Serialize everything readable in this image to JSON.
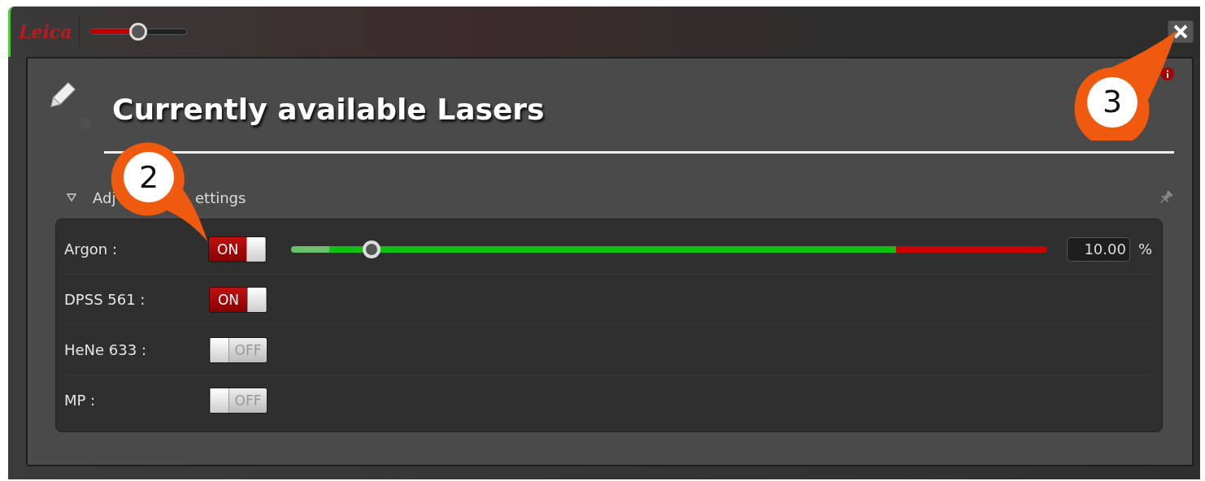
{
  "header": {
    "logo": "Leica",
    "zoom_slider": {
      "level": 0.5
    }
  },
  "panel": {
    "title": "Currently available Lasers"
  },
  "section": {
    "title_visible_start": "Adj",
    "title_visible_end": "ettings",
    "expanded": true,
    "lasers": [
      {
        "name": "Argon :",
        "on": true,
        "toggle_label": "ON",
        "power": {
          "level": 0.107,
          "value": "10.00",
          "unit": "%"
        }
      },
      {
        "name": "DPSS 561 :",
        "on": true,
        "toggle_label": "ON"
      },
      {
        "name": "HeNe 633 :",
        "on": false,
        "toggle_label": "OFF"
      },
      {
        "name": "MP :",
        "on": false,
        "toggle_label": "OFF"
      }
    ]
  },
  "callouts": [
    {
      "number": "2"
    },
    {
      "number": "3"
    }
  ]
}
